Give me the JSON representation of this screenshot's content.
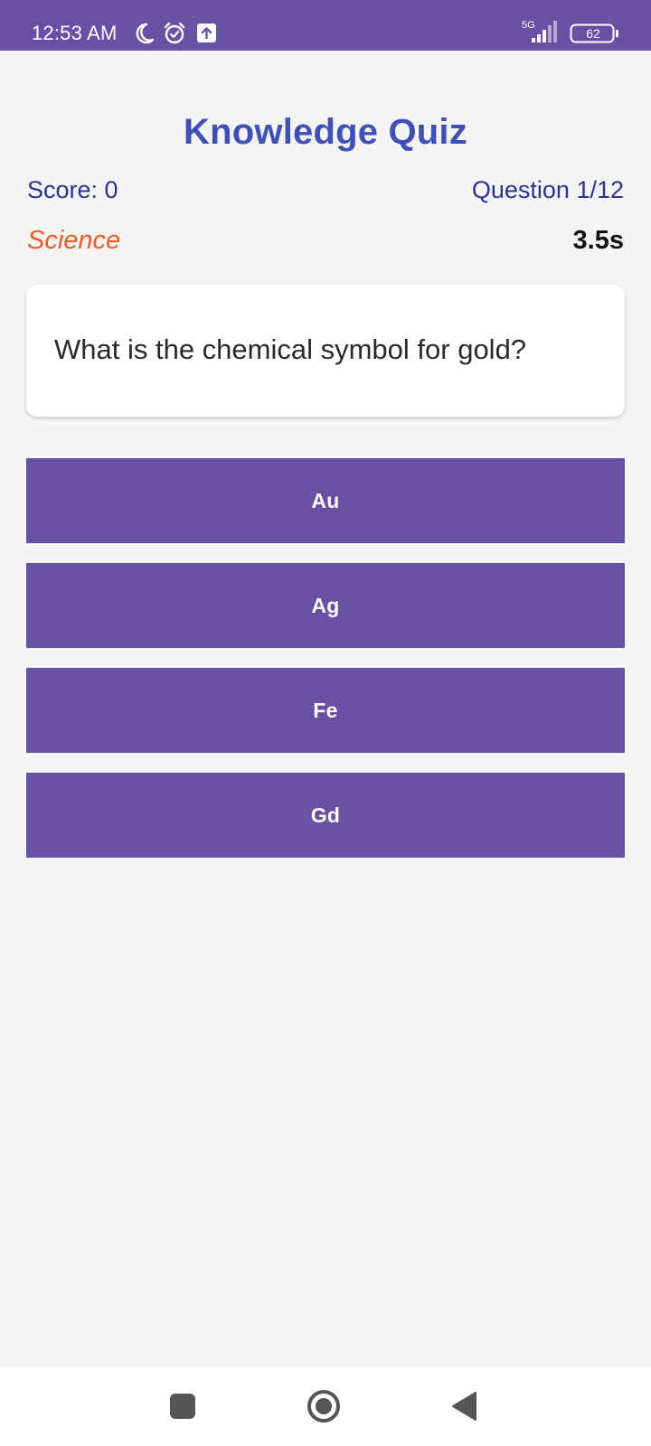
{
  "status_bar": {
    "time": "12:53 AM",
    "network": "5G",
    "battery": "62",
    "icons": [
      "moon-icon",
      "alarm-icon",
      "upload-icon",
      "signal-icon",
      "battery-icon"
    ]
  },
  "quiz": {
    "title": "Knowledge Quiz",
    "score": "Score: 0",
    "question_counter": "Question 1/12",
    "category": "Science",
    "timer": "3.5s",
    "question": "What is the chemical symbol for gold?",
    "answers": [
      {
        "label": "Au"
      },
      {
        "label": "Ag"
      },
      {
        "label": "Fe"
      },
      {
        "label": "Gd"
      }
    ]
  },
  "nav_bar": {
    "buttons": [
      "recent-apps-icon",
      "home-icon",
      "back-icon"
    ]
  },
  "colors": {
    "primary": "#6851a5",
    "title": "#3f51b5",
    "text_blue": "#283593",
    "category": "#ee5a24",
    "background": "#f4f4f4"
  }
}
